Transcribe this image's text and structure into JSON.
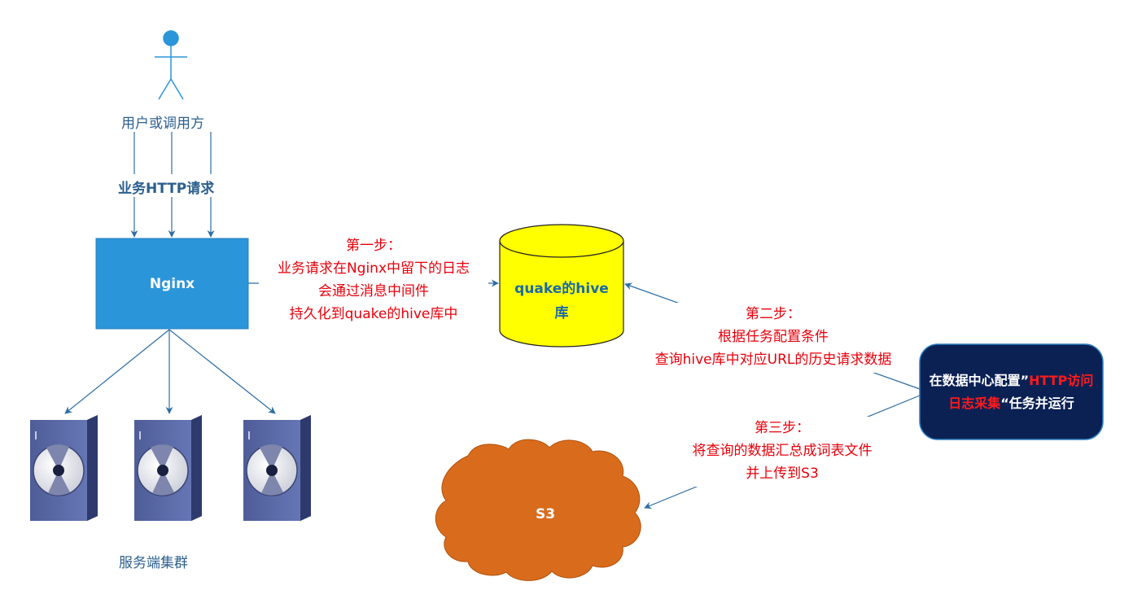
{
  "user": {
    "label": "用户或调用方"
  },
  "request": {
    "label": "业务HTTP请求"
  },
  "nginx": {
    "label": "Nginx"
  },
  "cluster": {
    "label": "服务端集群"
  },
  "step1": {
    "title": "第一步：",
    "line1": "业务请求在Nginx中留下的日志",
    "line2": "会通过消息中间件",
    "line3": "持久化到quake的hive库中"
  },
  "hive": {
    "line1": "quake的hive",
    "line2": "库"
  },
  "step2": {
    "title": "第二步：",
    "line1": "根据任务配置条件",
    "line2": "查询hive库中对应URL的历史请求数据"
  },
  "task": {
    "part1": "在数据中心配置”",
    "part2": "HTTP",
    "part3": "访问日志采集",
    "part4": "“任务并运",
    "part5": "行"
  },
  "step3": {
    "title": "第三步：",
    "line1": "将查询的数据汇总成词表文件",
    "line2": "并上传到S3"
  },
  "s3": {
    "label": "S3"
  },
  "colors": {
    "arrow": "#2e6da4",
    "nginx": "#2b95d9",
    "hive_fill": "#ffff00",
    "task_fill": "#0b2154",
    "cloud": "#d96c1c",
    "server": "#5a6aa6",
    "red_text": "#e8000b",
    "blue_text": "#2b5f8e"
  }
}
